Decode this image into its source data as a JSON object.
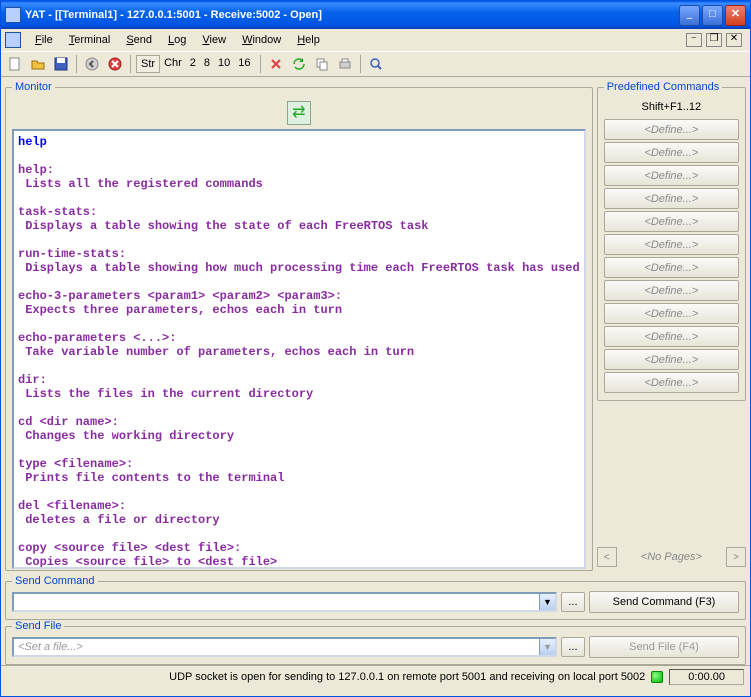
{
  "window": {
    "title": "YAT - [[Terminal1] - 127.0.0.1:5001 - Receive:5002 - Open]"
  },
  "menubar": [
    "File",
    "Terminal",
    "Send",
    "Log",
    "View",
    "Window",
    "Help"
  ],
  "mdi": {
    "min": "−",
    "restore": "❐",
    "close": "✕"
  },
  "winctrl": {
    "min": "_",
    "max": "□",
    "close": "✕"
  },
  "toolbar": {
    "radix": [
      "Str",
      "Chr",
      "2",
      "8",
      "10",
      "16"
    ],
    "selected": "Str"
  },
  "monitor": {
    "legend": "Monitor",
    "swap_icon": "⇄",
    "entered": "help",
    "lines": [
      "",
      "help:",
      " Lists all the registered commands",
      "",
      "task-stats:",
      " Displays a table showing the state of each FreeRTOS task",
      "",
      "run-time-stats:",
      " Displays a table showing how much processing time each FreeRTOS task has used",
      "",
      "echo-3-parameters <param1> <param2> <param3>:",
      " Expects three parameters, echos each in turn",
      "",
      "echo-parameters <...>:",
      " Take variable number of parameters, echos each in turn",
      "",
      "dir:",
      " Lists the files in the current directory",
      "",
      "cd <dir name>:",
      " Changes the working directory",
      "",
      "type <filename>:",
      " Prints file contents to the terminal",
      "",
      "del <filename>:",
      " deletes a file or directory",
      "",
      "copy <source file> <dest file>:",
      " Copies <source file> to <dest file>"
    ]
  },
  "commands": {
    "legend": "Predefined Commands",
    "hint": "Shift+F1..12",
    "define": "<Define...>",
    "count": 12,
    "pager": {
      "prev": "<",
      "next": ">",
      "label": "<No Pages>"
    }
  },
  "send_command": {
    "legend": "Send Command",
    "value": "",
    "browse": "...",
    "button": "Send Command (F3)"
  },
  "send_file": {
    "legend": "Send File",
    "placeholder": "<Set a file...>",
    "browse": "...",
    "button": "Send File (F4)"
  },
  "status": {
    "text": "UDP socket is open for sending to 127.0.0.1 on remote port 5001 and receiving on local port 5002",
    "time": "0:00.00"
  }
}
